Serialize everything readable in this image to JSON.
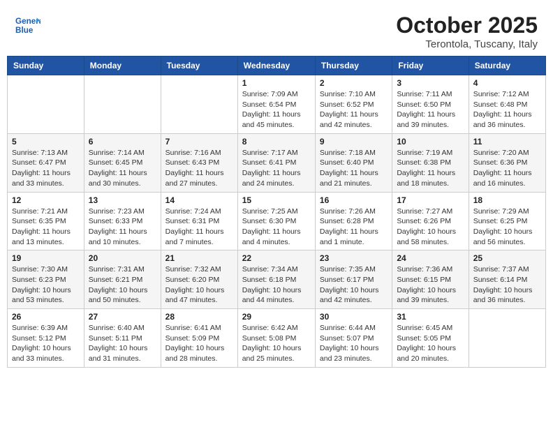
{
  "header": {
    "logo_text_general": "General",
    "logo_text_blue": "Blue",
    "title": "October 2025",
    "subtitle": "Terontola, Tuscany, Italy"
  },
  "weekdays": [
    "Sunday",
    "Monday",
    "Tuesday",
    "Wednesday",
    "Thursday",
    "Friday",
    "Saturday"
  ],
  "weeks": [
    [
      {
        "day": "",
        "info": ""
      },
      {
        "day": "",
        "info": ""
      },
      {
        "day": "",
        "info": ""
      },
      {
        "day": "1",
        "info": "Sunrise: 7:09 AM\nSunset: 6:54 PM\nDaylight: 11 hours and 45 minutes."
      },
      {
        "day": "2",
        "info": "Sunrise: 7:10 AM\nSunset: 6:52 PM\nDaylight: 11 hours and 42 minutes."
      },
      {
        "day": "3",
        "info": "Sunrise: 7:11 AM\nSunset: 6:50 PM\nDaylight: 11 hours and 39 minutes."
      },
      {
        "day": "4",
        "info": "Sunrise: 7:12 AM\nSunset: 6:48 PM\nDaylight: 11 hours and 36 minutes."
      }
    ],
    [
      {
        "day": "5",
        "info": "Sunrise: 7:13 AM\nSunset: 6:47 PM\nDaylight: 11 hours and 33 minutes."
      },
      {
        "day": "6",
        "info": "Sunrise: 7:14 AM\nSunset: 6:45 PM\nDaylight: 11 hours and 30 minutes."
      },
      {
        "day": "7",
        "info": "Sunrise: 7:16 AM\nSunset: 6:43 PM\nDaylight: 11 hours and 27 minutes."
      },
      {
        "day": "8",
        "info": "Sunrise: 7:17 AM\nSunset: 6:41 PM\nDaylight: 11 hours and 24 minutes."
      },
      {
        "day": "9",
        "info": "Sunrise: 7:18 AM\nSunset: 6:40 PM\nDaylight: 11 hours and 21 minutes."
      },
      {
        "day": "10",
        "info": "Sunrise: 7:19 AM\nSunset: 6:38 PM\nDaylight: 11 hours and 18 minutes."
      },
      {
        "day": "11",
        "info": "Sunrise: 7:20 AM\nSunset: 6:36 PM\nDaylight: 11 hours and 16 minutes."
      }
    ],
    [
      {
        "day": "12",
        "info": "Sunrise: 7:21 AM\nSunset: 6:35 PM\nDaylight: 11 hours and 13 minutes."
      },
      {
        "day": "13",
        "info": "Sunrise: 7:23 AM\nSunset: 6:33 PM\nDaylight: 11 hours and 10 minutes."
      },
      {
        "day": "14",
        "info": "Sunrise: 7:24 AM\nSunset: 6:31 PM\nDaylight: 11 hours and 7 minutes."
      },
      {
        "day": "15",
        "info": "Sunrise: 7:25 AM\nSunset: 6:30 PM\nDaylight: 11 hours and 4 minutes."
      },
      {
        "day": "16",
        "info": "Sunrise: 7:26 AM\nSunset: 6:28 PM\nDaylight: 11 hours and 1 minute."
      },
      {
        "day": "17",
        "info": "Sunrise: 7:27 AM\nSunset: 6:26 PM\nDaylight: 10 hours and 58 minutes."
      },
      {
        "day": "18",
        "info": "Sunrise: 7:29 AM\nSunset: 6:25 PM\nDaylight: 10 hours and 56 minutes."
      }
    ],
    [
      {
        "day": "19",
        "info": "Sunrise: 7:30 AM\nSunset: 6:23 PM\nDaylight: 10 hours and 53 minutes."
      },
      {
        "day": "20",
        "info": "Sunrise: 7:31 AM\nSunset: 6:21 PM\nDaylight: 10 hours and 50 minutes."
      },
      {
        "day": "21",
        "info": "Sunrise: 7:32 AM\nSunset: 6:20 PM\nDaylight: 10 hours and 47 minutes."
      },
      {
        "day": "22",
        "info": "Sunrise: 7:34 AM\nSunset: 6:18 PM\nDaylight: 10 hours and 44 minutes."
      },
      {
        "day": "23",
        "info": "Sunrise: 7:35 AM\nSunset: 6:17 PM\nDaylight: 10 hours and 42 minutes."
      },
      {
        "day": "24",
        "info": "Sunrise: 7:36 AM\nSunset: 6:15 PM\nDaylight: 10 hours and 39 minutes."
      },
      {
        "day": "25",
        "info": "Sunrise: 7:37 AM\nSunset: 6:14 PM\nDaylight: 10 hours and 36 minutes."
      }
    ],
    [
      {
        "day": "26",
        "info": "Sunrise: 6:39 AM\nSunset: 5:12 PM\nDaylight: 10 hours and 33 minutes."
      },
      {
        "day": "27",
        "info": "Sunrise: 6:40 AM\nSunset: 5:11 PM\nDaylight: 10 hours and 31 minutes."
      },
      {
        "day": "28",
        "info": "Sunrise: 6:41 AM\nSunset: 5:09 PM\nDaylight: 10 hours and 28 minutes."
      },
      {
        "day": "29",
        "info": "Sunrise: 6:42 AM\nSunset: 5:08 PM\nDaylight: 10 hours and 25 minutes."
      },
      {
        "day": "30",
        "info": "Sunrise: 6:44 AM\nSunset: 5:07 PM\nDaylight: 10 hours and 23 minutes."
      },
      {
        "day": "31",
        "info": "Sunrise: 6:45 AM\nSunset: 5:05 PM\nDaylight: 10 hours and 20 minutes."
      },
      {
        "day": "",
        "info": ""
      }
    ]
  ]
}
